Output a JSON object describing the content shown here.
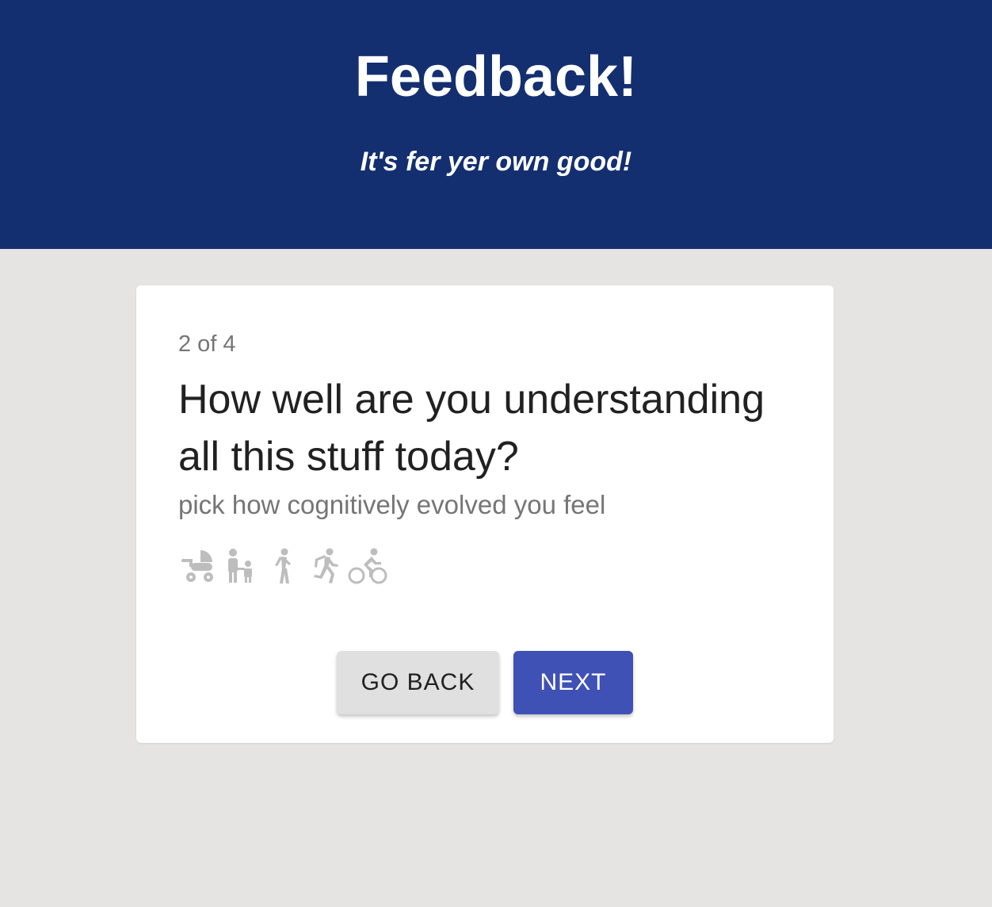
{
  "header": {
    "title": "Feedback!",
    "subtitle": "It's fer yer own good!"
  },
  "card": {
    "progress": "2 of 4",
    "question": "How well are you understanding all this stuff today?",
    "hint": "pick how cognitively evolved you feel",
    "rating_options": [
      {
        "icon": "stroller-icon"
      },
      {
        "icon": "family-icon"
      },
      {
        "icon": "walking-icon"
      },
      {
        "icon": "running-icon"
      },
      {
        "icon": "cycling-icon"
      }
    ],
    "buttons": {
      "back_label": "GO BACK",
      "next_label": "NEXT"
    }
  },
  "colors": {
    "header_bg": "#132f70",
    "page_bg": "#e5e4e2",
    "primary": "#3f51b5",
    "icon": "#bdbdbd"
  }
}
